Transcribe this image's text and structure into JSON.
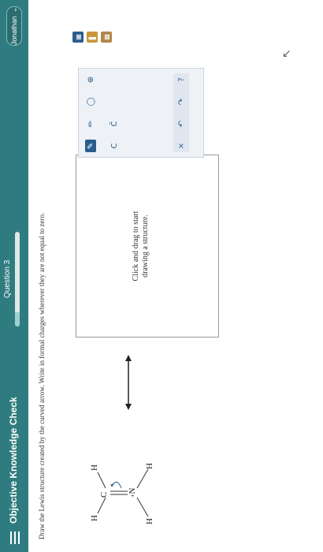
{
  "app": {
    "title": "Objective Knowledge Check"
  },
  "question": {
    "label": "Question 3",
    "progress": 0.15
  },
  "user": {
    "name": "Jonathan",
    "menu_icon": "chevron-down-icon"
  },
  "prompt": {
    "text": "Draw the Lewis structure created by the curved arrow. Write in formal charges wherever they are not equal to zero."
  },
  "molecule": {
    "atoms": [
      "H",
      "C",
      "H",
      "N",
      "H",
      "H"
    ],
    "central_charge": "+"
  },
  "canvas": {
    "hint_line1": "Click and drag to start",
    "hint_line2": "drawing a structure."
  },
  "palette": {
    "tools_row1": [
      "eraser-icon",
      "pencil-icon",
      "ring-icon",
      "charge-plus-icon"
    ],
    "tools_row2_labels": [
      "C",
      "C̈"
    ],
    "controls": {
      "clear": "×",
      "undo": "↶",
      "redo": "↷",
      "help": "?"
    }
  },
  "colors": {
    "topbar": "#2f7c80",
    "accent": "#2b5d8c",
    "page": "#ffffff"
  }
}
